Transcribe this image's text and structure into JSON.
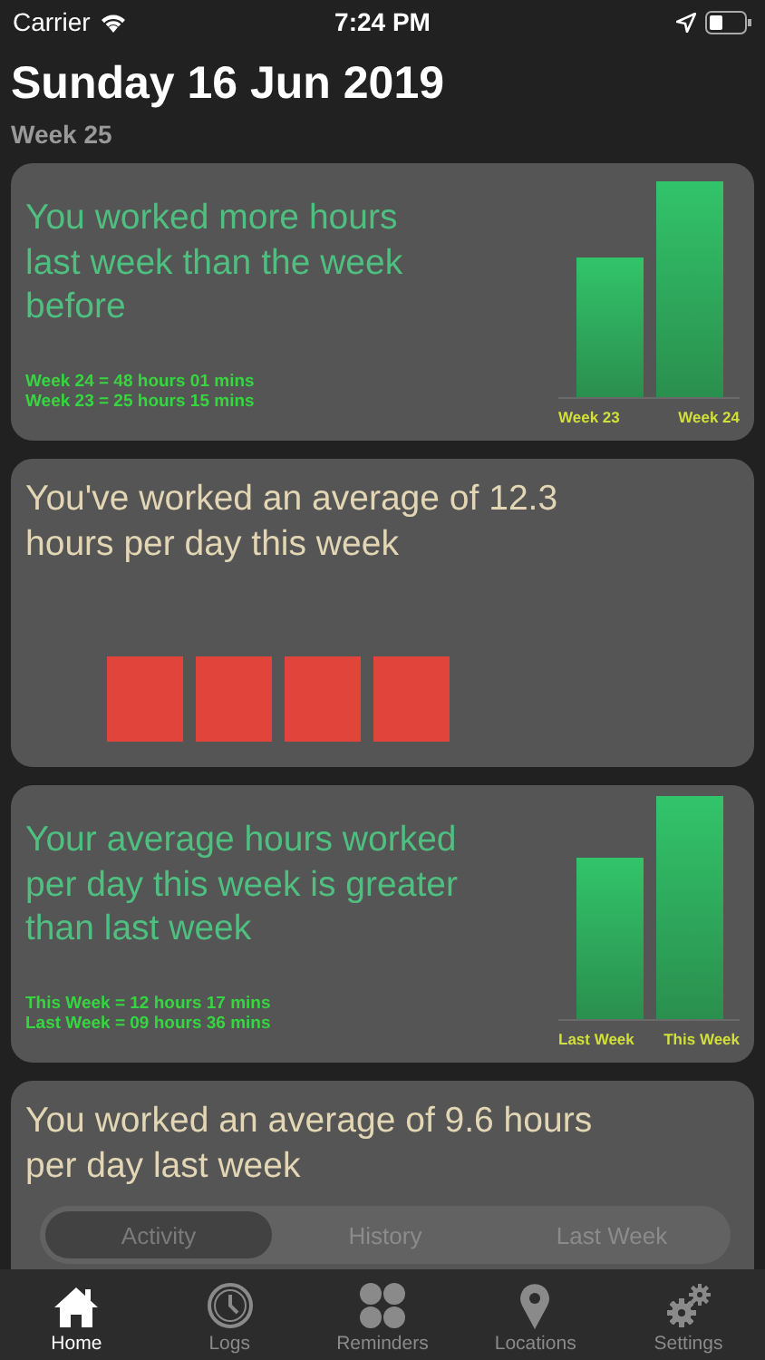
{
  "status_bar": {
    "carrier": "Carrier",
    "time": "7:24 PM"
  },
  "header": {
    "date": "Sunday 16 Jun 2019",
    "week": "Week 25"
  },
  "cards": [
    {
      "kind": "compare",
      "title": "You worked more hours last week than the week before",
      "stats": [
        "Week 24 = 48 hours 01 mins",
        "Week 23 = 25 hours 15 mins"
      ],
      "bars": [
        "Week 23",
        "Week 24"
      ]
    },
    {
      "kind": "blocks",
      "title": "You've worked an average of 12.3 hours per day this week"
    },
    {
      "kind": "compare",
      "title": "Your average hours worked per day this week is greater than last week",
      "stats": [
        "This Week = 12 hours 17 mins",
        "Last Week = 09 hours 36 mins"
      ],
      "bars": [
        "Last Week",
        "This Week"
      ]
    },
    {
      "kind": "text",
      "title": "You worked an average of 9.6 hours per day last week"
    }
  ],
  "segments": [
    {
      "label": "Activity",
      "selected": true
    },
    {
      "label": "History",
      "selected": false
    },
    {
      "label": "Last Week",
      "selected": false
    }
  ],
  "tabs": [
    {
      "label": "Home",
      "selected": true
    },
    {
      "label": "Logs",
      "selected": false
    },
    {
      "label": "Reminders",
      "selected": false
    },
    {
      "label": "Locations",
      "selected": false
    },
    {
      "label": "Settings",
      "selected": false
    }
  ]
}
